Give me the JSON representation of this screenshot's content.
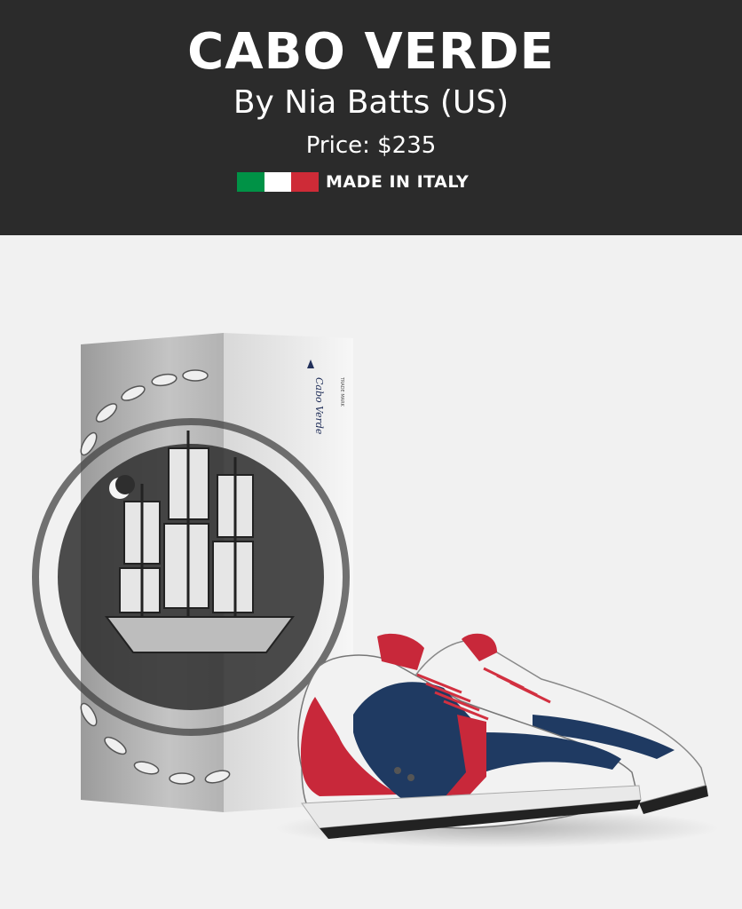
{
  "product": {
    "title": "CABO VERDE",
    "designer": "By Nia Batts (US)",
    "price": "Price: $235",
    "origin_label": "MADE IN ITALY",
    "flag_colors": [
      "#009246",
      "#ffffff",
      "#ce2b37"
    ]
  },
  "box": {
    "brand_text": "Cabo Verde",
    "trademark_text": "TRADE MARK"
  },
  "shoe": {
    "colors": {
      "primary": "#1f3a62",
      "accent": "#c8283a",
      "base": "#f2f2f2"
    }
  }
}
